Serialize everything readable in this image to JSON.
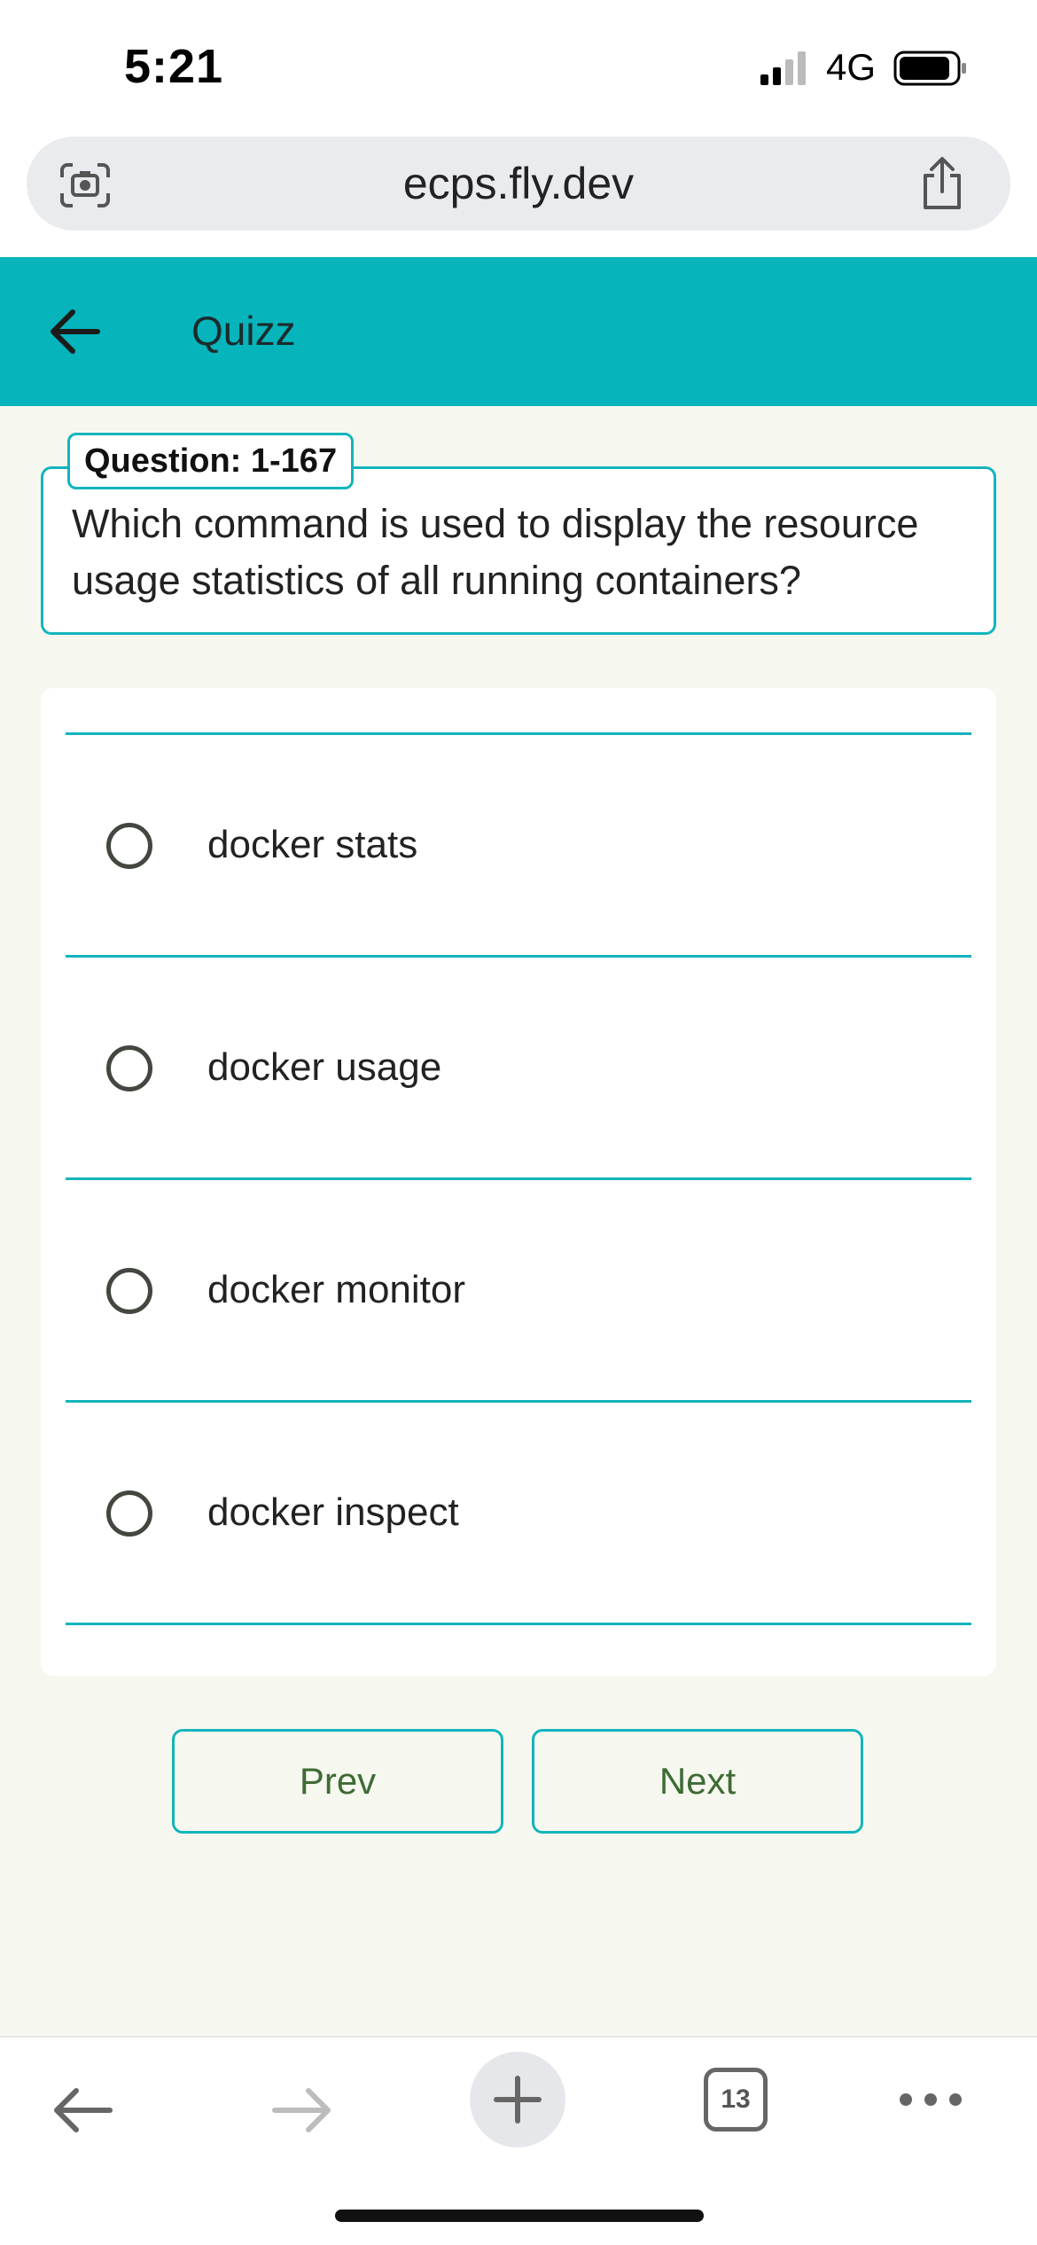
{
  "status_bar": {
    "time": "5:21",
    "network": "4G"
  },
  "browser": {
    "url": "ecps.fly.dev"
  },
  "app_bar": {
    "title": "Quizz"
  },
  "question": {
    "tag": "Question: 1-167",
    "text": "Which command is used to display the resource usage statistics of all running containers?"
  },
  "options": [
    {
      "label": "docker stats",
      "selected": false
    },
    {
      "label": "docker usage",
      "selected": false
    },
    {
      "label": "docker monitor",
      "selected": false
    },
    {
      "label": "docker inspect",
      "selected": false
    }
  ],
  "navigation": {
    "prev_label": "Prev",
    "next_label": "Next"
  },
  "toolbar": {
    "tab_count": "13"
  },
  "colors": {
    "accent": "#06b4bc",
    "border": "#13b4bc",
    "button_text": "#3e6b34",
    "page_bg": "#f6f8f0"
  }
}
